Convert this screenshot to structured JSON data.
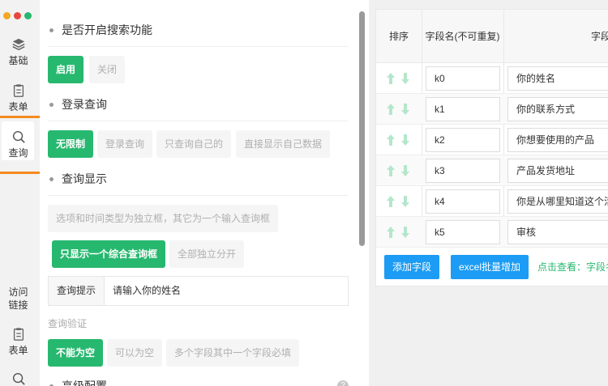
{
  "window": {
    "dot_colors": [
      "#f5a623",
      "#e8453c",
      "#27b86f"
    ]
  },
  "rail": {
    "items": [
      {
        "label": "基础",
        "icon": "layers-icon"
      },
      {
        "label": "表单",
        "icon": "clipboard-icon"
      },
      {
        "label": "查询",
        "icon": "search-icon"
      },
      {
        "label": "访问\n链接",
        "label_line1": "访问",
        "label_line2": "链接",
        "icon": ""
      },
      {
        "label": "表单",
        "icon": "clipboard-icon"
      },
      {
        "label": "",
        "icon": "search-icon"
      }
    ],
    "highlight_color": "#f58a1f"
  },
  "settings": {
    "search_toggle": {
      "title": "是否开启搜索功能",
      "enable": "启用",
      "disable": "关闭"
    },
    "login_query": {
      "title": "登录查询",
      "options": [
        "无限制",
        "登录查询",
        "只查询自己的",
        "直接显示自己数据"
      ]
    },
    "query_display": {
      "title": "查询显示",
      "option_separate": "选项和时间类型为独立框，其它为一个输入查询框",
      "option_combined": "只显示一个综合查询框",
      "option_all_separate": "全部独立分开"
    },
    "query_tip": {
      "label": "查询提示",
      "value": "请输入你的姓名"
    },
    "query_validation": {
      "label": "查询验证",
      "options": [
        "不能为空",
        "可以为空",
        "多个字段其中一个字段必填"
      ]
    },
    "advanced": {
      "title": "高级配置",
      "help_icon": "question-circle-icon"
    }
  },
  "fields_table": {
    "headers": {
      "sort": "排序",
      "key": "字段名(不可重复)",
      "name": "字段"
    },
    "rows": [
      {
        "key": "k0",
        "name": "你的姓名"
      },
      {
        "key": "k1",
        "name": "你的联系方式"
      },
      {
        "key": "k2",
        "name": "你想要使用的产品"
      },
      {
        "key": "k3",
        "name": "产品发货地址"
      },
      {
        "key": "k4",
        "name": "你是从哪里知道这个活"
      },
      {
        "key": "k5",
        "name": "审核"
      }
    ],
    "add_field": "添加字段",
    "excel_add": "excel批量增加",
    "view_link": "点击查看：字段名"
  },
  "colors": {
    "accent_green": "#27b86f",
    "accent_blue": "#1c9cf4",
    "arrow_green": "#b5e6cc"
  }
}
